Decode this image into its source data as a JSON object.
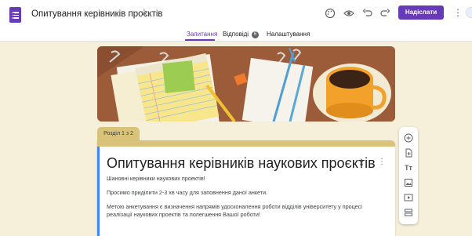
{
  "header": {
    "title": "Опитування керівників проєктів",
    "send_label": "Надіслати"
  },
  "icons": {
    "star": "star-icon",
    "palette": "palette-icon",
    "preview": "eye-icon",
    "undo": "undo-icon",
    "redo": "redo-icon",
    "more": "more-vert-icon"
  },
  "tabs": [
    {
      "label": "Запитання",
      "active": true
    },
    {
      "label": "Відповіді",
      "badge": "6"
    },
    {
      "label": "Налаштування"
    }
  ],
  "section": {
    "label": "Розділ 1 з 2"
  },
  "form": {
    "title": "Опитування керівників наукових проєктів",
    "description": [
      "Шановні керівники наукових проектів!",
      "Просимо приділити 2-3 хв часу для заповнення даної анкети.",
      "Метою анкетування є визначення напрямів удосконалення роботи відділів університету у процесі",
      "реалізації наукових проектів та полегшення Вашої роботи!"
    ]
  },
  "floating_toolbar": [
    "add-question-icon",
    "import-questions-icon",
    "add-title-icon",
    "add-image-icon",
    "add-video-icon",
    "add-section-icon"
  ],
  "colors": {
    "accent": "#673ab7",
    "theme": "#d9c37a",
    "background": "#f6f0db",
    "focus": "#4285f4"
  }
}
